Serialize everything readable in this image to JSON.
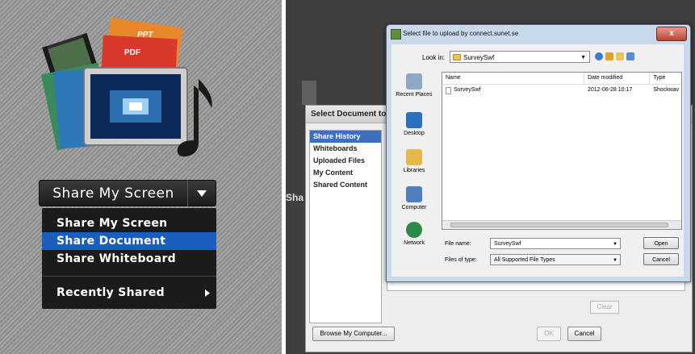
{
  "share_pod": {
    "button_label": "Share My Screen",
    "thumb_labels": {
      "ppt": "PPT",
      "pdf": "PDF"
    },
    "menu": [
      {
        "label": "Share My Screen",
        "selected": false
      },
      {
        "label": "Share Document",
        "selected": true
      },
      {
        "label": "Share Whiteboard",
        "selected": false
      }
    ],
    "recently_shared": "Recently Shared",
    "accent": "#1a5fc0"
  },
  "background_dialog": {
    "title": "Select Document to Sh",
    "partial_text": "Sha",
    "sidebar": [
      "Share History",
      "Whiteboards",
      "Uploaded Files",
      "My Content",
      "Shared Content"
    ],
    "clear_label": "Clear",
    "browse_label": "Browse My Computer...",
    "ok_label": "OK",
    "cancel_label": "Cancel"
  },
  "file_dialog": {
    "title": "Select file to upload by connect.sunet.se",
    "close_label": "x",
    "look_in_label": "Look in:",
    "look_in_value": "SurveySwf",
    "places": [
      "Recent Places",
      "Desktop",
      "Libraries",
      "Computer",
      "Network"
    ],
    "columns": [
      "Name",
      "Date modified",
      "Type"
    ],
    "rows": [
      {
        "name": "SurveySwf",
        "date": "2012-06-28 10:17",
        "type": "Shockwav"
      }
    ],
    "file_name_label": "File name:",
    "file_name_value": "SurveySwf",
    "files_of_type_label": "Files of type:",
    "files_of_type_value": "All Supported File Types",
    "open_label": "Open",
    "cancel_label": "Cancel"
  }
}
